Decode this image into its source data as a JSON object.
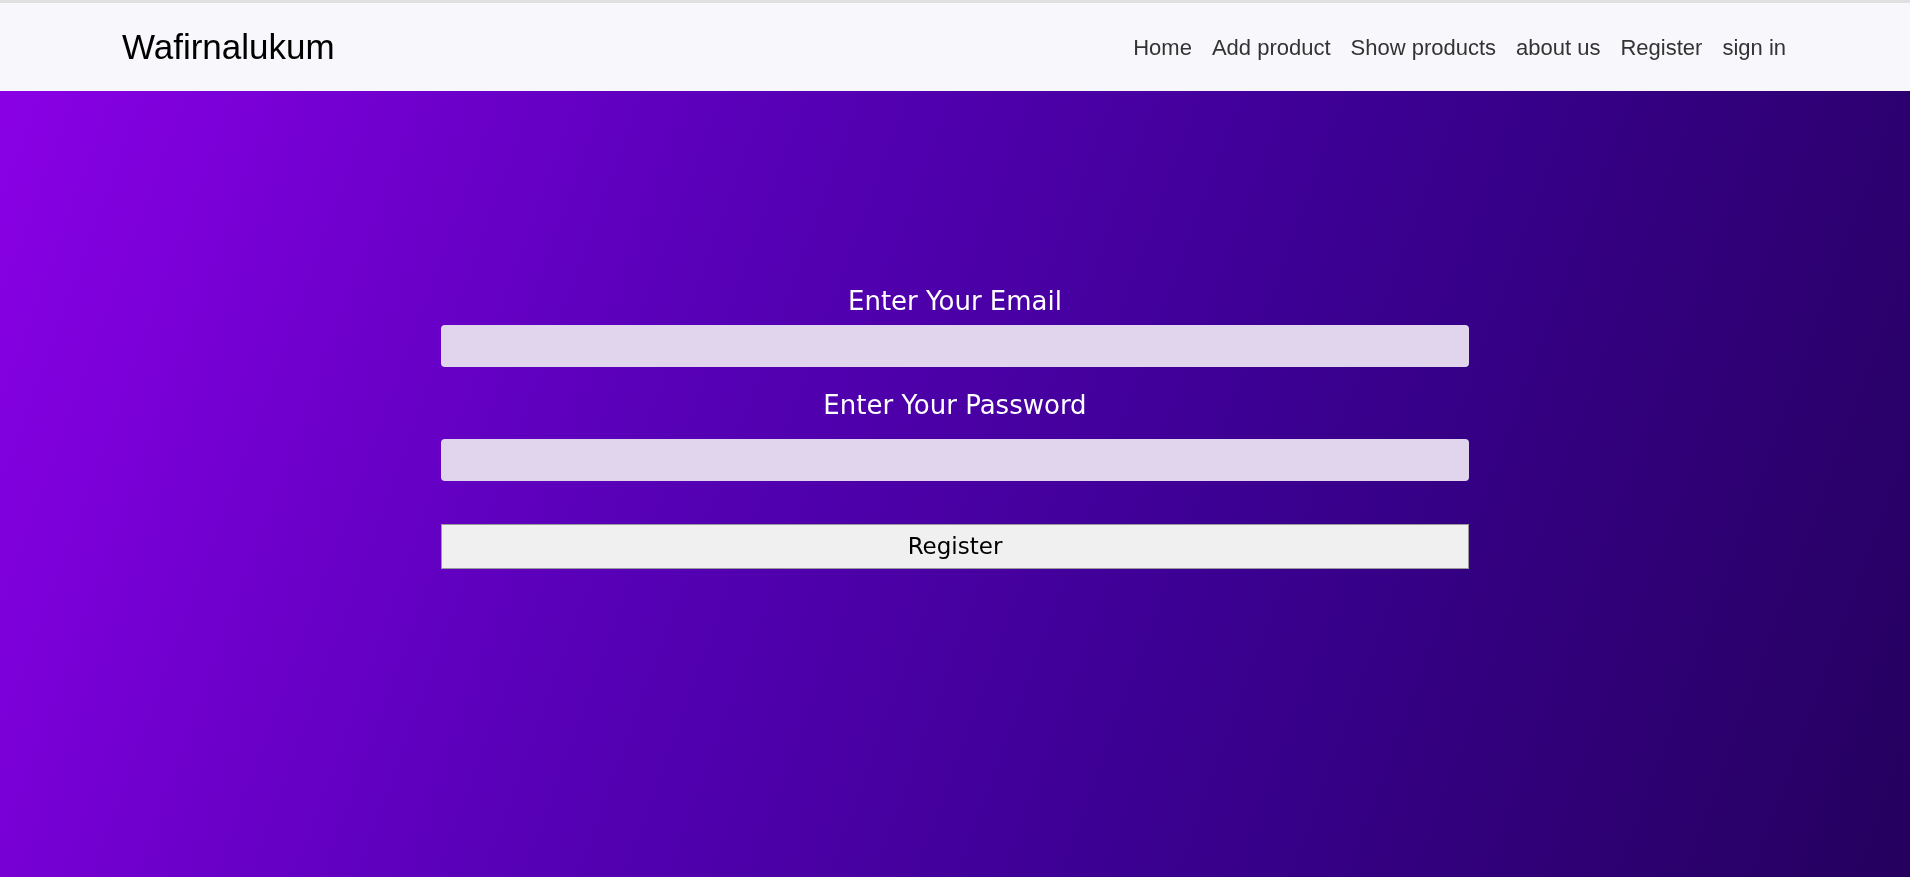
{
  "navbar": {
    "brand": "Wafirnalukum",
    "links": [
      "Home",
      "Add product",
      "Show products",
      "about us",
      "Register",
      "sign in"
    ]
  },
  "form": {
    "email_label": "Enter Your Email",
    "password_label": "Enter Your Password",
    "submit": "Register"
  }
}
